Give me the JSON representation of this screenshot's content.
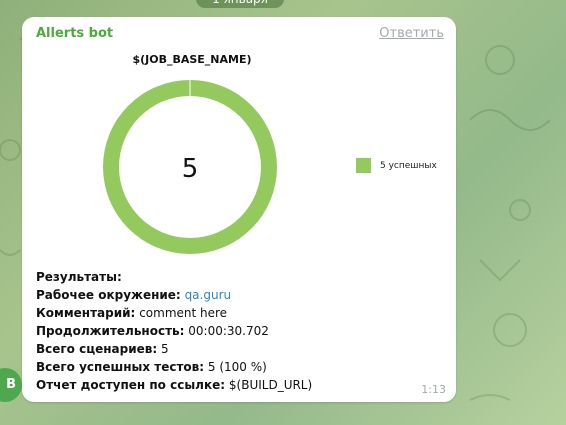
{
  "chat": {
    "date_pill": "1 января",
    "avatar_letter": "B"
  },
  "message": {
    "sender": "Allerts bot",
    "reply_label": "Ответить",
    "time": "1:13",
    "lines": [
      {
        "label": "Результаты:",
        "value": ""
      },
      {
        "label": "Рабочее окружение:",
        "value": "qa.guru",
        "is_link": true
      },
      {
        "label": "Комментарий:",
        "value": "comment here"
      },
      {
        "label": "Продолжительность:",
        "value": "00:00:30.702"
      },
      {
        "label": "Всего сценариев:",
        "value": "5"
      },
      {
        "label": "Всего успешных тестов:",
        "value": "5 (100 %)"
      },
      {
        "label": "Отчет доступен по ссылке:",
        "value": "$(BUILD_URL)"
      }
    ]
  },
  "chart_data": {
    "type": "pie",
    "title": "$(JOB_BASE_NAME)",
    "center_label": "5",
    "categories": [
      "5 успешных"
    ],
    "values": [
      5
    ],
    "colors": [
      "#94c95e"
    ],
    "legend": "right"
  }
}
